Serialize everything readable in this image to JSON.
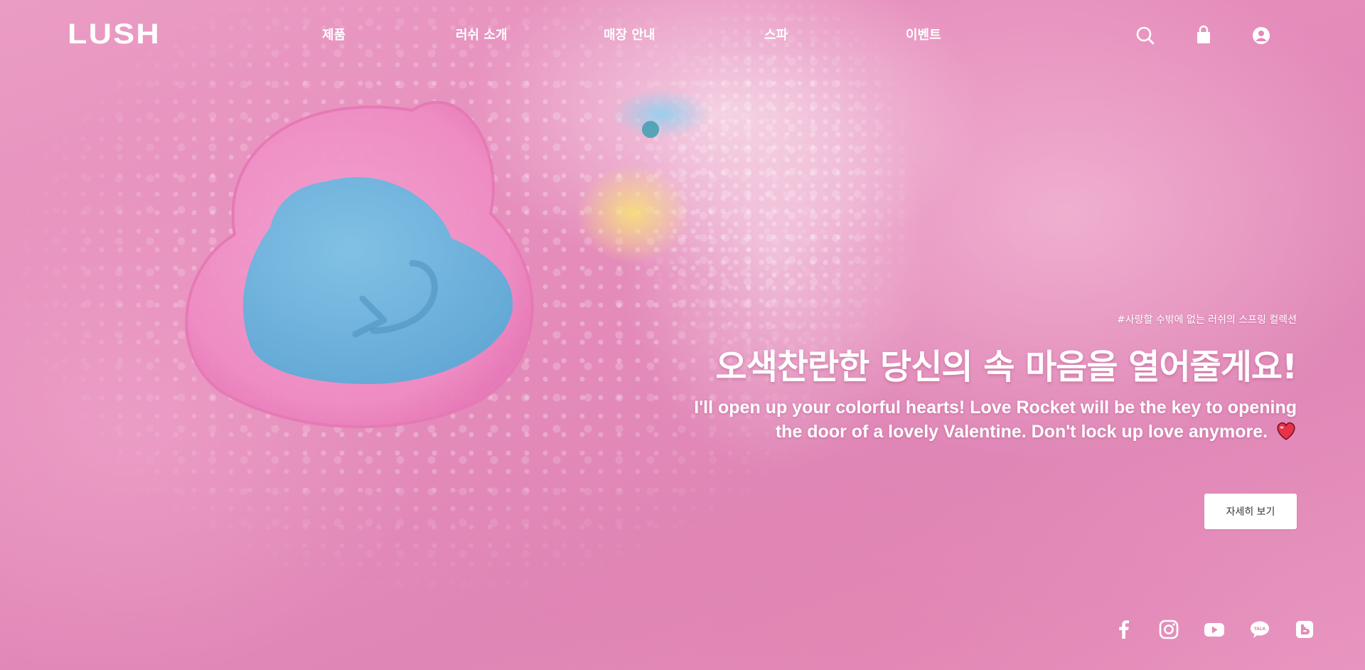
{
  "header": {
    "logo": "LUSH",
    "nav": [
      {
        "label": "제품"
      },
      {
        "label": "러쉬 소개"
      },
      {
        "label": "매장 안내"
      },
      {
        "label": "스파"
      },
      {
        "label": "이벤트"
      }
    ],
    "utility_icons": [
      "search-icon",
      "shopping-bag-icon",
      "user-account-icon"
    ]
  },
  "hero": {
    "hashtag": "#사랑할 수밖에 없는 러쉬의 스프링 컬렉션",
    "headline": "오색찬란한 당신의 속 마음을 열어줄게요!",
    "subcopy_line1": "I'll open up your colorful hearts! Love Rocket will be the key to opening",
    "subcopy_line2": "the door of a lovely Valentine. Don't lock up love anymore.",
    "subcopy_emoji": "heart-emoji-icon",
    "cta_label": "자세히 보기"
  },
  "social": [
    "facebook-icon",
    "instagram-icon",
    "youtube-icon",
    "kakaotalk-icon",
    "blog-icon"
  ],
  "colors": {
    "background_pink": "#e48ab6",
    "bath_bomb_blue": "#6cb6dc",
    "heart_pink": "#f08cc4",
    "text_white": "#ffffff",
    "button_text": "#333333"
  }
}
